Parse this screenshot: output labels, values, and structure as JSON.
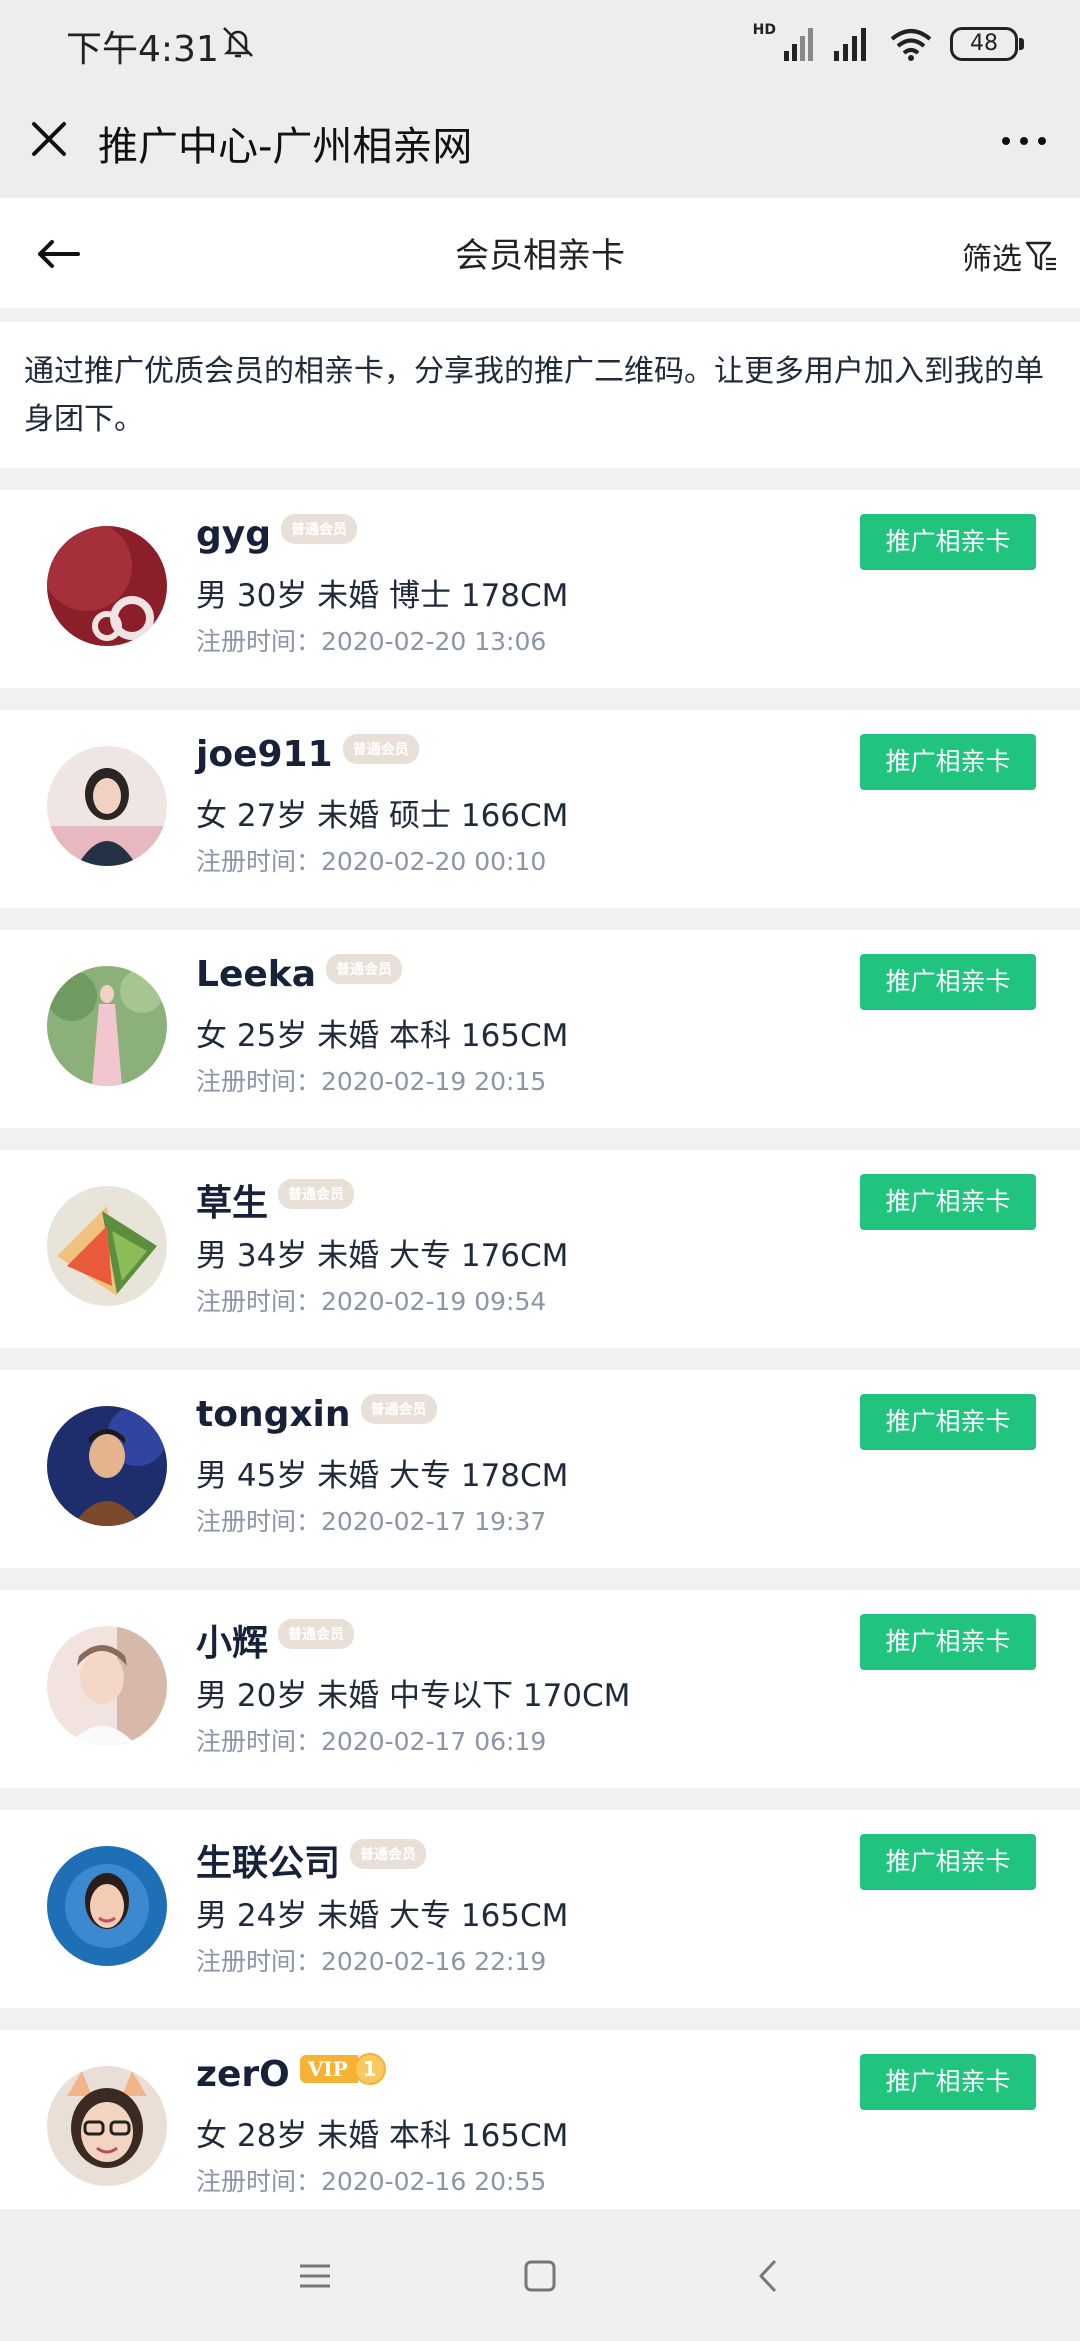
{
  "status_bar": {
    "time": "下午4:31",
    "hd_label": "HD",
    "battery": "48",
    "icons": [
      "mute-icon",
      "cellular-signal-icon",
      "cellular-signal-icon",
      "wifi-icon",
      "battery-icon"
    ]
  },
  "title_bar": {
    "title": "推广中心-广州相亲网",
    "close_icon": "close-icon",
    "more_icon": "more-icon"
  },
  "header": {
    "title": "会员相亲卡",
    "back_icon": "arrow-left-icon",
    "filter_label": "筛选",
    "filter_icon": "filter-icon"
  },
  "intro": {
    "text": "通过推广优质会员的相亲卡，分享我的推广二维码。让更多用户加入到我的单身团下。"
  },
  "colors": {
    "accent_green": "#21c47e",
    "badge_bg": "#e8dfd7",
    "vip_gold": "#f7b233",
    "muted_text": "#8a95a5"
  },
  "members": [
    {
      "name": "gyg",
      "badge": "普通会员",
      "vip": false,
      "info": "男 30岁 未婚 博士 178CM",
      "reg_time": "注册时间：2020-02-20 13:06",
      "button": "推广相亲卡",
      "avatar": "avatar-red"
    },
    {
      "name": "joe911",
      "badge": "普通会员",
      "vip": false,
      "info": "女 27岁 未婚 硕士 166CM",
      "reg_time": "注册时间：2020-02-20 00:10",
      "button": "推广相亲卡",
      "avatar": "avatar-woman"
    },
    {
      "name": "Leeka",
      "badge": "普通会员",
      "vip": false,
      "info": "女 25岁 未婚 本科 165CM",
      "reg_time": "注册时间：2020-02-19 20:15",
      "button": "推广相亲卡",
      "avatar": "avatar-garden"
    },
    {
      "name": "草生",
      "badge": "普通会员",
      "vip": false,
      "info": "男 34岁 未婚 大专 176CM",
      "reg_time": "注册时间：2020-02-19 09:54",
      "button": "推广相亲卡",
      "avatar": "avatar-food"
    },
    {
      "name": "tongxin",
      "badge": "普通会员",
      "vip": false,
      "info": "男 45岁 未婚 大专 178CM",
      "reg_time": "注册时间：2020-02-17 19:37",
      "button": "推广相亲卡",
      "avatar": "avatar-man"
    },
    {
      "name": "小辉",
      "badge": "普通会员",
      "vip": false,
      "info": "男 20岁 未婚 中专以下 170CM",
      "reg_time": "注册时间：2020-02-17 06:19",
      "button": "推广相亲卡",
      "avatar": "avatar-light"
    },
    {
      "name": "生联公司",
      "badge": "普通会员",
      "vip": false,
      "info": "男 24岁 未婚 大专 165CM",
      "reg_time": "注册时间：2020-02-16 22:19",
      "button": "推广相亲卡",
      "avatar": "avatar-blue"
    },
    {
      "name": "zerO",
      "badge": "VIP",
      "badge_num": "1",
      "vip": true,
      "info": "女 28岁 未婚 本科 165CM",
      "reg_time": "注册时间：2020-02-16 20:55",
      "button": "推广相亲卡",
      "avatar": "avatar-glasses"
    }
  ],
  "nav_bar": {
    "icons": [
      "menu-icon",
      "home-square-icon",
      "back-chevron-icon"
    ]
  }
}
